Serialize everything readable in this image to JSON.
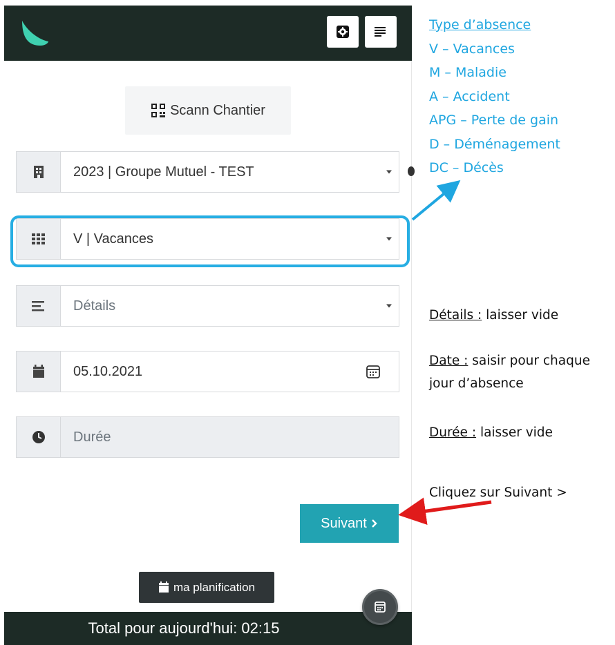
{
  "topbar": {
    "logo_icon": "leaf-logo",
    "settings_icon": "gear-icon",
    "menu_icon": "menu-lines-icon"
  },
  "scann": {
    "label": "Scann Chantier",
    "icon": "qr-code-icon"
  },
  "form": {
    "project": {
      "value": "2023 | Groupe Mutuel - TEST",
      "icon": "building-icon"
    },
    "absence_type": {
      "value": "V | Vacances",
      "icon": "grid-icon"
    },
    "details": {
      "placeholder": "Détails",
      "icon": "align-lines-icon"
    },
    "date": {
      "value": "05.10.2021",
      "icon": "calendar-icon"
    },
    "duration": {
      "placeholder": "Durée",
      "icon": "clock-icon"
    }
  },
  "buttons": {
    "next_label": "Suivant",
    "planning_label": "ma planification"
  },
  "footer": {
    "total_text": "Total pour aujourd'hui: 02:15"
  },
  "legend": {
    "title": "Type d’absence",
    "items": [
      "V – Vacances",
      "M – Maladie",
      "A – Accident",
      "APG – Perte de gain",
      "D – Déménagement",
      "DC – Décès"
    ]
  },
  "notes": {
    "details_label": "Détails :",
    "details_text": " laisser vide",
    "date_label": "Date :",
    "date_text": " saisir pour chaque jour d’absence",
    "duree_label": "Durée :",
    "duree_text": " laisser vide",
    "suivant_text": "Cliquez sur Suivant >"
  },
  "colors": {
    "dark_bar": "#1d2b26",
    "accent_teal": "#22a3b2",
    "highlight_blue": "#27aee3",
    "legend_blue": "#1fa6e0",
    "arrow_red": "#e01b1b"
  }
}
